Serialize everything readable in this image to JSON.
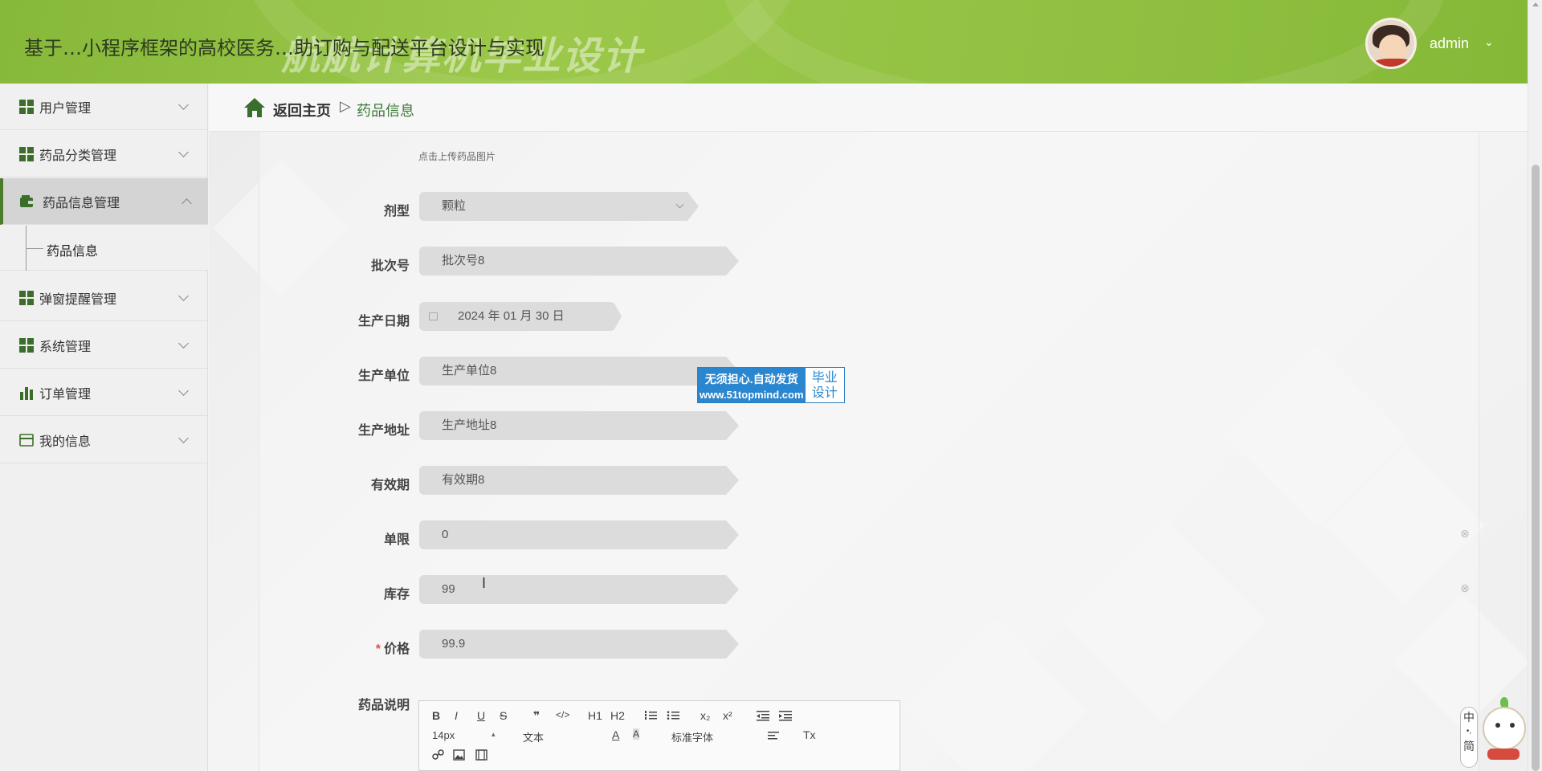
{
  "header": {
    "title": "基于…小程序框架的高校医务…助订购与配送平台设计与实现",
    "watermark": "航航计算机毕业设计",
    "watermark_logo": "bilibili",
    "user_name": "admin"
  },
  "sidebar": {
    "items": [
      {
        "label": "用户管理",
        "icon": "grid-icon"
      },
      {
        "label": "药品分类管理",
        "icon": "grid-icon"
      },
      {
        "label": "药品信息管理",
        "icon": "wallet-icon",
        "active": true
      },
      {
        "label": "弹窗提醒管理",
        "icon": "grid-icon"
      },
      {
        "label": "系统管理",
        "icon": "grid-icon"
      },
      {
        "label": "订单管理",
        "icon": "bar-chart-icon"
      },
      {
        "label": "我的信息",
        "icon": "card-icon"
      }
    ],
    "submenu": {
      "label": "药品信息"
    }
  },
  "breadcrumb": {
    "home": "返回主页",
    "separator": "▷",
    "current": "药品信息"
  },
  "form": {
    "upload_hint": "点击上传药品图片",
    "fields": [
      {
        "label": "剂型",
        "value": "颗粒",
        "type": "select"
      },
      {
        "label": "批次号",
        "value": "批次号8"
      },
      {
        "label": "生产日期",
        "value": "2024 年 01 月 30 日",
        "type": "date"
      },
      {
        "label": "生产单位",
        "value": "生产单位8"
      },
      {
        "label": "生产地址",
        "value": "生产地址8"
      },
      {
        "label": "有效期",
        "value": "有效期8"
      },
      {
        "label": "单限",
        "value": "0"
      },
      {
        "label": "库存",
        "value": "99"
      },
      {
        "label": "价格",
        "value": "99.9",
        "required": true
      }
    ],
    "description_label": "药品说明",
    "required_mark": "*"
  },
  "editor": {
    "buttons_row1": [
      "B",
      "I",
      "U",
      "S",
      "❞",
      "</>",
      "H1",
      "H2",
      "list-ol",
      "list-ul",
      "x₂",
      "x²",
      "indent-out",
      "indent-in"
    ],
    "font_size": "14px",
    "text_style": "文本",
    "font_family": "标准字体",
    "clear_format": "Tx"
  },
  "ad": {
    "line1": "无须担心.自动发货",
    "line2": "www.51topmind.com",
    "right1": "毕业",
    "right2": "设计"
  },
  "side_widget": {
    "lang": "中",
    "mode": "简"
  },
  "colors": {
    "header_green": "#9cc84a",
    "accent_green": "#3b6e2a",
    "breadcrumb_active": "#3c7a3a",
    "ad_blue": "#2a86cf",
    "required_red": "#d9534f"
  }
}
